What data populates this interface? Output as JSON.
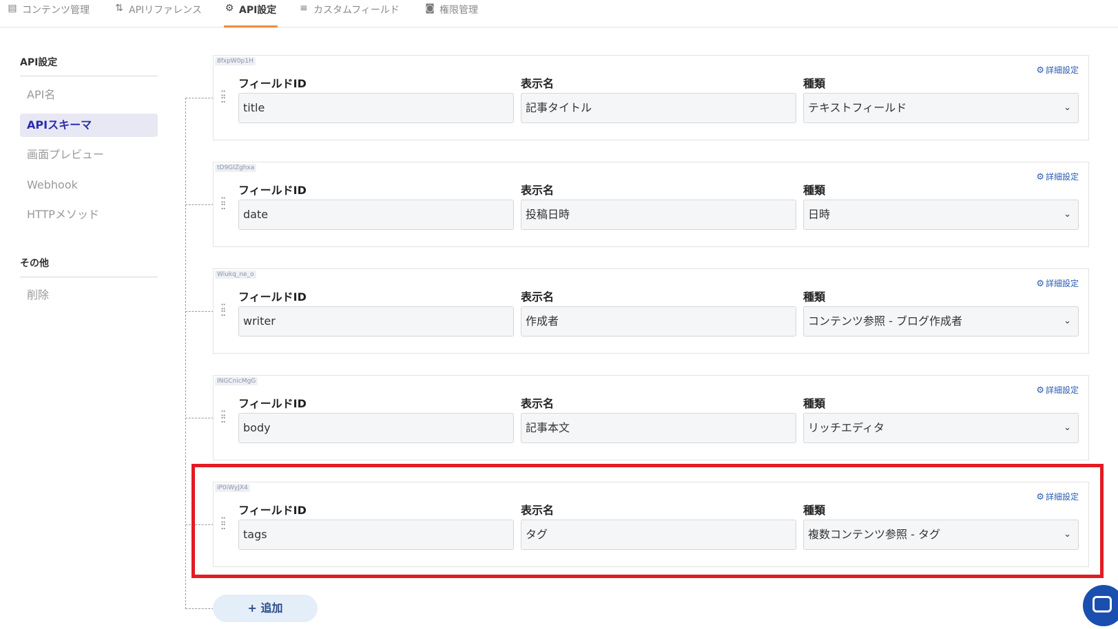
{
  "tabs": [
    {
      "label": "コンテンツ管理",
      "icon": "document-icon",
      "glyph": "▤"
    },
    {
      "label": "APIリファレンス",
      "icon": "sort-arrows-icon",
      "glyph": "⇅"
    },
    {
      "label": "API設定",
      "icon": "gear-icon",
      "glyph": "⚙"
    },
    {
      "label": "カスタムフィールド",
      "icon": "list-add-icon",
      "glyph": "≡"
    },
    {
      "label": "権限管理",
      "icon": "user-badge-icon",
      "glyph": "◙"
    }
  ],
  "active_tab": "API設定",
  "sidebar": {
    "section1_title": "API設定",
    "items": [
      "API名",
      "APIスキーマ",
      "画面プレビュー",
      "Webhook",
      "HTTPメソッド"
    ],
    "active_item": "APIスキーマ",
    "section2_title": "その他",
    "items2": [
      "削除"
    ]
  },
  "labels": {
    "field_id": "フィールドID",
    "display_name": "表示名",
    "type": "種類",
    "detail": "詳細設定"
  },
  "fields": [
    {
      "uid": "8fxpW0p1H",
      "field_id": "title",
      "display_name": "記事タイトル",
      "type": "テキストフィールド"
    },
    {
      "uid": "tD9GIZghxa",
      "field_id": "date",
      "display_name": "投稿日時",
      "type": "日時"
    },
    {
      "uid": "Wiukq_ne_o",
      "field_id": "writer",
      "display_name": "作成者",
      "type": "コンテンツ参照 - ブログ作成者"
    },
    {
      "uid": "INGCnicMgG",
      "field_id": "body",
      "display_name": "記事本文",
      "type": "リッチエディタ"
    },
    {
      "uid": "iP0iWyJX4",
      "field_id": "tags",
      "display_name": "タグ",
      "type": "複数コンテンツ参照 - タグ"
    }
  ],
  "highlighted_field": "tags",
  "add_button": "+ 追加",
  "colors": {
    "accent_tab": "#f0883e",
    "active_nav": "#2b2bb0",
    "highlight_border": "#e31b23",
    "link": "#2c5db0"
  }
}
